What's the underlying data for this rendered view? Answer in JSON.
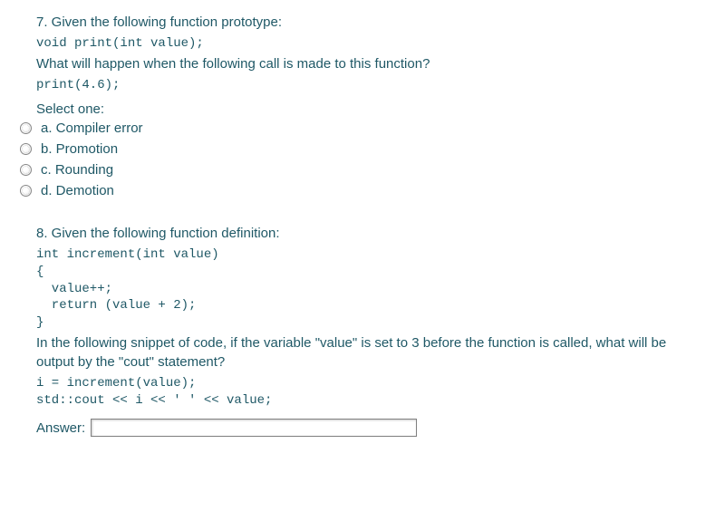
{
  "q7": {
    "prompt_line1": "7. Given the following function prototype:",
    "code1": "void print(int value);",
    "prompt_line2": "What will happen when the following call is made to this function?",
    "code2": "print(4.6);",
    "select_label": "Select one:",
    "options": [
      {
        "label": "a. Compiler error"
      },
      {
        "label": "b. Promotion"
      },
      {
        "label": "c. Rounding"
      },
      {
        "label": "d. Demotion"
      }
    ]
  },
  "q8": {
    "prompt_line1": "8. Given the following function definition:",
    "code_block": "int increment(int value)\n{\n  value++;\n  return (value + 2);\n}",
    "prompt_line2": "In the following snippet of code, if the variable \"value\" is set to 3 before the function is called, what will be output by the \"cout\" statement?",
    "code2": "i = increment(value);\nstd::cout << i << ' ' << value;",
    "answer_label": "Answer:",
    "answer_value": ""
  }
}
